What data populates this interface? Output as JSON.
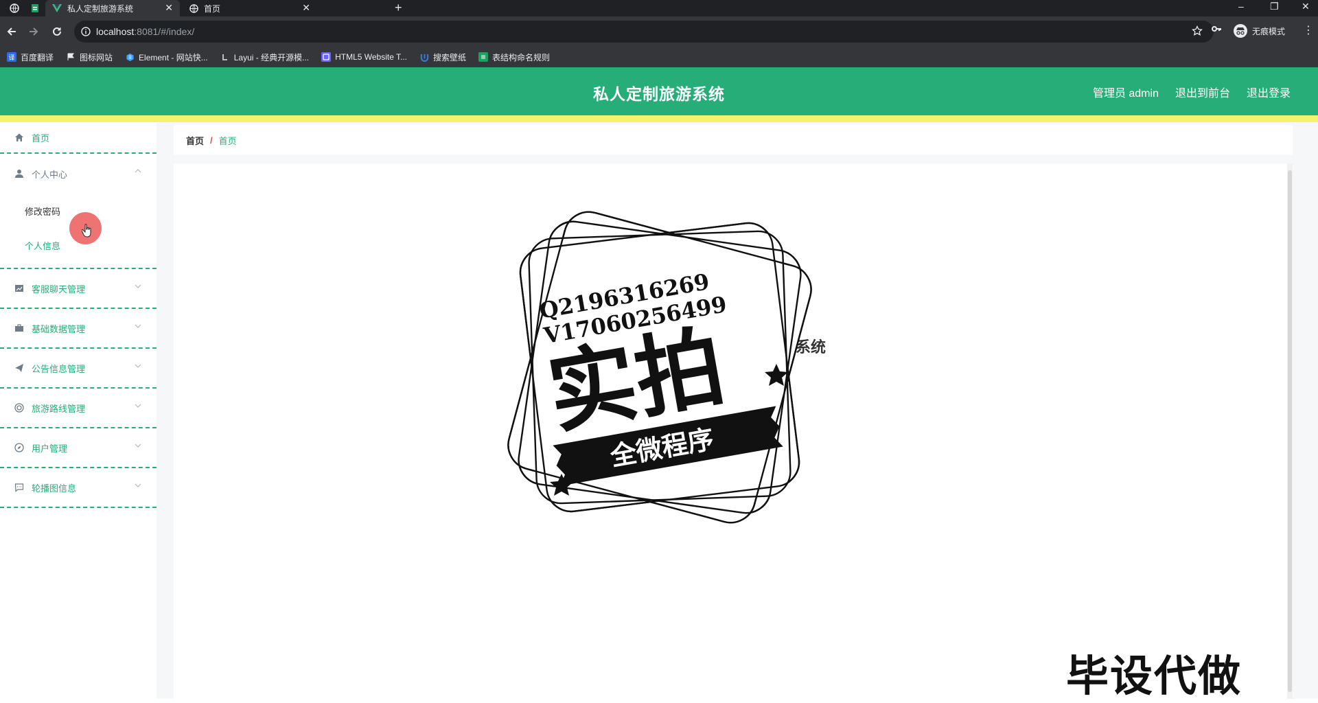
{
  "browser": {
    "tabs": [
      {
        "title": "私人定制旅游系统",
        "active": true
      },
      {
        "title": "首页",
        "active": false
      }
    ],
    "url_host": "localhost",
    "url_rest": ":8081/#/index/",
    "incognito_label": "无痕模式",
    "bookmarks": [
      {
        "label": "百度翻译",
        "color": "#2b6de8"
      },
      {
        "label": "图标网站",
        "color": "#e8eaed"
      },
      {
        "label": "Element - 网站快...",
        "color": "#409eff"
      },
      {
        "label": "Layui - 经典开源模...",
        "color": "#8d8d8d"
      },
      {
        "label": "HTML5 Website T...",
        "color": "#6b63ff"
      },
      {
        "label": "搜索壁纸",
        "color": "#3a7bd5"
      },
      {
        "label": "表结构命名规则",
        "color": "#1aa260"
      }
    ]
  },
  "header": {
    "title": "私人定制旅游系统",
    "admin_label": "管理员 admin",
    "front_link": "退出到前台",
    "logout_link": "退出登录"
  },
  "sidebar": {
    "home": "首页",
    "personal_center": "个人中心",
    "sub_items": [
      {
        "label": "修改密码",
        "active": false
      },
      {
        "label": "个人信息",
        "active": true
      }
    ],
    "groups": [
      {
        "label": "客服聊天管理",
        "icon": "chart-icon"
      },
      {
        "label": "基础数据管理",
        "icon": "briefcase-icon"
      },
      {
        "label": "公告信息管理",
        "icon": "send-icon"
      },
      {
        "label": "旅游路线管理",
        "icon": "target-icon"
      },
      {
        "label": "用户管理",
        "icon": "compass-icon"
      },
      {
        "label": "轮播图信息",
        "icon": "message-icon"
      }
    ]
  },
  "breadcrumb": {
    "root": "首页",
    "separator": "/",
    "current": "首页"
  },
  "main": {
    "welcome": "欢迎使用 私人定制旅游系统"
  },
  "watermark": {
    "stamp_line1": "Q2196316269",
    "stamp_line2": "V17060256499",
    "stamp_big": "实拍",
    "stamp_banner": "全微程序",
    "corner": "毕设代做"
  },
  "colors": {
    "primary": "#27ae78",
    "accent_bar": "#f5f26d",
    "cursor": "#ea5454"
  }
}
